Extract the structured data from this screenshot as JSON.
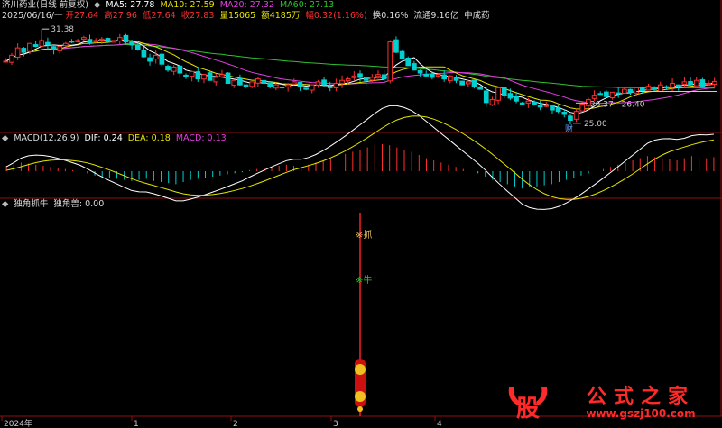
{
  "header": {
    "stock_name": "济川药业(日线 前复权)",
    "ma5": "MA5: 27.78",
    "ma10": "MA10: 27.59",
    "ma20": "MA20: 27.32",
    "ma60": "MA60: 27.13",
    "date": "2025/06/16/一",
    "open": "开27.64",
    "high": "高27.96",
    "low": "低27.64",
    "close": "收27.83",
    "volume": "量15065",
    "amount": "额4185万",
    "change": "幅0.32(1.16%)",
    "turnover": "换0.16%",
    "float_cap": "流通9.16亿",
    "sector": "中成药"
  },
  "macd_header": {
    "title": "MACD(12,26,9)",
    "dif": "DIF: 0.24",
    "dea": "DEA: 0.18",
    "macd": "MACD: 0.13"
  },
  "ind_header": {
    "title": "独角抓牛",
    "value": "独角兽: 0.00"
  },
  "annotations": {
    "high_marker": "31.38",
    "low_marker": "25.00",
    "range_label": "26.37 - 26.40",
    "cai_label": "财",
    "signal_zhua": "抓",
    "signal_niu": "牛"
  },
  "x_axis": {
    "labels": [
      "2024年",
      "1",
      "2",
      "3",
      "4"
    ]
  },
  "watermark": {
    "logo_char": "股",
    "site_name": "公式之家",
    "url": "www.gszj100.com"
  },
  "colors": {
    "ma5": "#ffffff",
    "ma10": "#e5e500",
    "ma20": "#e040e0",
    "ma60": "#30c030",
    "up": "#ff3030",
    "down": "#00d0d0",
    "signal": "#ff2020"
  },
  "chart_data": {
    "type": "candlestick",
    "title": "济川药业(日线 前复权)",
    "price_ylim": [
      24.5,
      32
    ],
    "annotated_high": 31.38,
    "annotated_low": 25.0,
    "range_band": [
      26.37,
      26.4
    ],
    "last_bar": {
      "open": 27.64,
      "high": 27.96,
      "low": 27.64,
      "close": 27.83
    },
    "ma": {
      "MA5": 27.78,
      "MA10": 27.59,
      "MA20": 27.32,
      "MA60": 27.13
    },
    "closes": [
      29.2,
      29.6,
      30.1,
      29.8,
      30.4,
      30.2,
      30.6,
      30.3,
      30.0,
      30.2,
      30.4,
      30.5,
      30.6,
      30.8,
      30.4,
      30.6,
      30.7,
      30.5,
      30.6,
      30.8,
      30.5,
      30.3,
      30.0,
      29.5,
      29.2,
      29.6,
      29.0,
      28.6,
      28.8,
      28.4,
      28.2,
      28.5,
      28.0,
      28.3,
      27.9,
      28.1,
      28.3,
      27.7,
      27.9,
      27.6,
      27.5,
      27.8,
      28.0,
      27.7,
      27.5,
      27.6,
      27.4,
      27.6,
      27.8,
      27.5,
      27.3,
      27.6,
      27.8,
      27.6,
      27.4,
      27.7,
      27.9,
      28.0,
      28.2,
      28.1,
      27.9,
      28.1,
      28.3,
      28.0,
      30.5,
      29.8,
      29.4,
      28.9,
      28.6,
      28.4,
      28.2,
      28.1,
      28.3,
      28.0,
      28.2,
      27.9,
      27.6,
      27.8,
      27.5,
      27.3,
      26.4,
      26.6,
      27.4,
      26.9,
      26.7,
      26.5,
      26.3,
      26.5,
      26.3,
      26.1,
      26.2,
      25.9,
      25.8,
      25.6,
      25.2,
      25.8,
      26.3,
      26.6,
      26.9,
      27.0,
      26.8,
      27.1,
      27.0,
      27.3,
      27.1,
      27.4,
      27.2,
      27.5,
      27.3,
      27.6,
      27.4,
      27.7,
      27.5,
      27.8,
      27.6,
      27.9,
      27.5,
      27.7,
      27.83
    ],
    "macd": {
      "dif": 0.24,
      "dea": 0.18,
      "hist": [
        0.05,
        0.06,
        0.08,
        0.07,
        0.06,
        0.05,
        0.04,
        0.03,
        0.02,
        0.01,
        0.0,
        -0.02,
        -0.04,
        -0.05,
        -0.06,
        -0.07,
        -0.08,
        -0.09,
        -0.08,
        -0.07,
        -0.09,
        -0.1,
        -0.11,
        -0.12,
        -0.1,
        -0.08,
        -0.07,
        -0.06,
        -0.05,
        -0.04,
        -0.03,
        -0.02,
        -0.01,
        0.01,
        0.02,
        0.03,
        0.04,
        0.05,
        0.06,
        0.05,
        0.04,
        0.06,
        0.08,
        0.1,
        0.12,
        0.14,
        0.16,
        0.18,
        0.2,
        0.22,
        0.24,
        0.25,
        0.24,
        0.22,
        0.2,
        0.18,
        0.15,
        0.12,
        0.1,
        0.08,
        0.06,
        0.04,
        0.02,
        0.0,
        -0.02,
        -0.05,
        -0.08,
        -0.1,
        -0.12,
        -0.14,
        -0.16,
        -0.15,
        -0.14,
        -0.13,
        -0.12,
        -0.1,
        -0.08,
        -0.06,
        -0.04,
        -0.02,
        0.0,
        0.02,
        0.04,
        0.06,
        0.08,
        0.1,
        0.12,
        0.14,
        0.13,
        0.12,
        0.11,
        0.1,
        0.12,
        0.14,
        0.13,
        0.12,
        0.13
      ]
    },
    "signal_bar_index": 59,
    "x_tick_labels": [
      "2024年",
      "1",
      "2",
      "3",
      "4"
    ]
  }
}
